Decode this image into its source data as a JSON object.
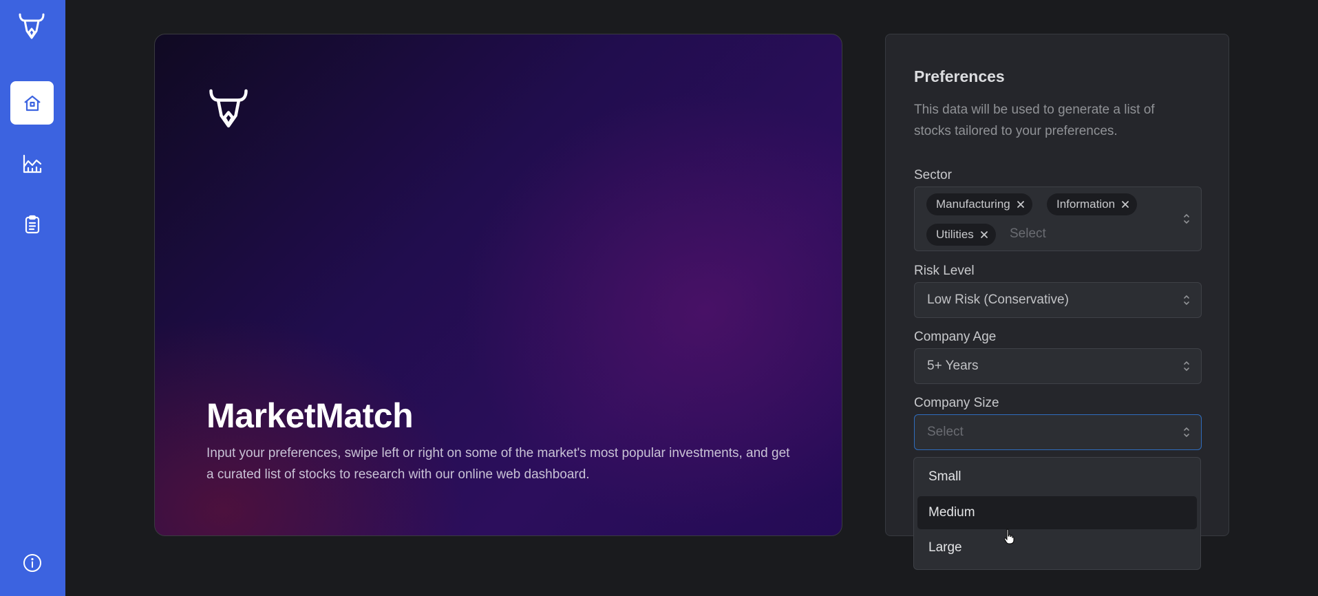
{
  "sidebar": {
    "logo_icon": "bull-logo-icon",
    "items": [
      {
        "icon": "home-icon",
        "active": true
      },
      {
        "icon": "chart-icon",
        "active": false
      },
      {
        "icon": "clipboard-icon",
        "active": false
      }
    ],
    "footer_icon": "info-icon",
    "accent_color": "#3c63e0"
  },
  "hero": {
    "title": "MarketMatch",
    "description": "Input your preferences, swipe left or right on some of the market's most popular investments, and get a curated list of stocks to research with our online web dashboard."
  },
  "preferences": {
    "title": "Preferences",
    "description": "This data will be used to generate a list of stocks tailored to your preferences.",
    "sector": {
      "label": "Sector",
      "selected": [
        "Manufacturing",
        "Information",
        "Utilities"
      ],
      "placeholder": "Select"
    },
    "risk_level": {
      "label": "Risk Level",
      "value": "Low Risk (Conservative)"
    },
    "company_age": {
      "label": "Company Age",
      "value": "5+ Years"
    },
    "company_size": {
      "label": "Company Size",
      "placeholder": "Select",
      "options": [
        "Small",
        "Medium",
        "Large"
      ],
      "hovered_option": "Medium"
    }
  }
}
